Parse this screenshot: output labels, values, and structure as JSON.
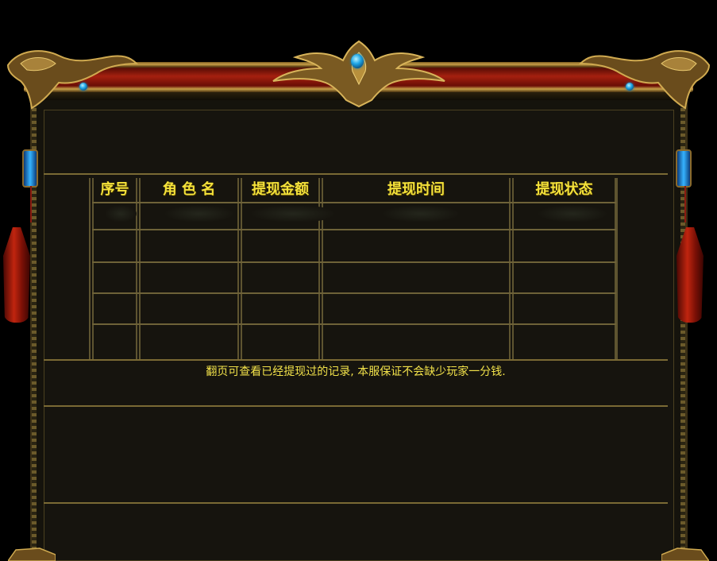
{
  "table": {
    "headers": [
      "序号",
      "角 色 名",
      "提现金额",
      "提现时间",
      "提现状态"
    ],
    "rows": [
      [
        "",
        "",
        "",
        "",
        ""
      ],
      [
        "",
        "",
        "",
        "",
        ""
      ],
      [
        "",
        "",
        "",
        "",
        ""
      ],
      [
        "",
        "",
        "",
        "",
        ""
      ],
      [
        "",
        "",
        "",
        "",
        ""
      ]
    ]
  },
  "notice": "翻页可查看已经提现过的记录, 本服保证不会缺少玩家一分钱.",
  "colors": {
    "header_text": "#f4e23a",
    "panel_bg": "#16140e",
    "frame_gold": "#c8a048",
    "frame_red": "#a5200f",
    "gem_blue": "#1fa6e6"
  },
  "icons": [
    "gem-icon",
    "lantern-icon",
    "tassel-icon",
    "dragon-ornament-icon"
  ]
}
